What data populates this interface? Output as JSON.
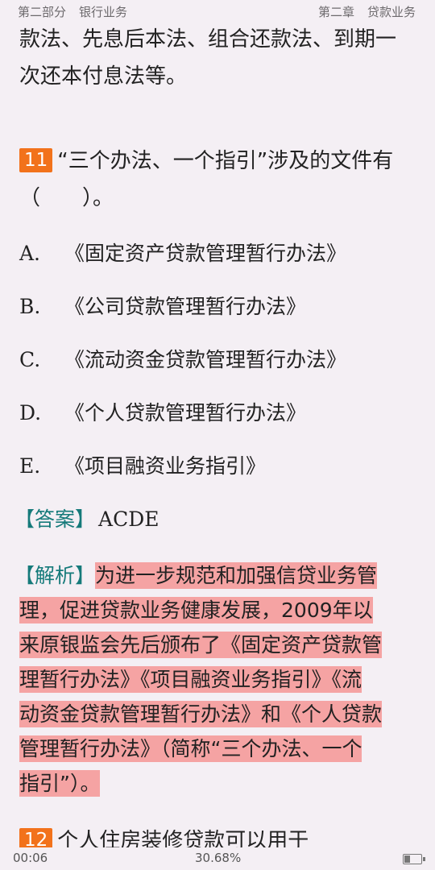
{
  "header": {
    "part": "第二部分",
    "part_title": "银行业务",
    "chapter": "第二章",
    "chapter_title": "贷款业务"
  },
  "intro_lines": [
    "款法、先息后本法、组合还款法、到期一",
    "次还本付息法等。"
  ],
  "question": {
    "number": "11",
    "text_line1": "“三个办法、一个指引”涉及的文件有",
    "text_line2": "（　　）。",
    "options": [
      {
        "letter": "A.",
        "text": "《固定资产贷款管理暂行办法》"
      },
      {
        "letter": "B.",
        "text": "《公司贷款管理暂行办法》"
      },
      {
        "letter": "C.",
        "text": "《流动资金贷款管理暂行办法》"
      },
      {
        "letter": "D.",
        "text": "《个人贷款管理暂行办法》"
      },
      {
        "letter": "E.",
        "text": "《项目融资业务指引》"
      }
    ]
  },
  "answer": {
    "tag": "【答案】",
    "value": "ACDE"
  },
  "analysis": {
    "tag": "【解析】",
    "lines": [
      "为进一步规范和加强信贷业务管",
      "理，促进贷款业务健康发展，2009年以",
      "来原银监会先后颁布了《固定资产贷款管",
      "理暂行办法》《项目融资业务指引》《流",
      "动资金贷款管理暂行办法》和《个人贷款",
      "管理暂行办法》（简称“三个办法、一个",
      "指引”）。"
    ],
    "highlight_color": "#f5a3a3"
  },
  "next_question": {
    "number": "12",
    "text": "个人住房装修贷款可以用于"
  },
  "footer": {
    "time": "00:06",
    "progress": "30.68%",
    "battery_level": 0.3
  }
}
